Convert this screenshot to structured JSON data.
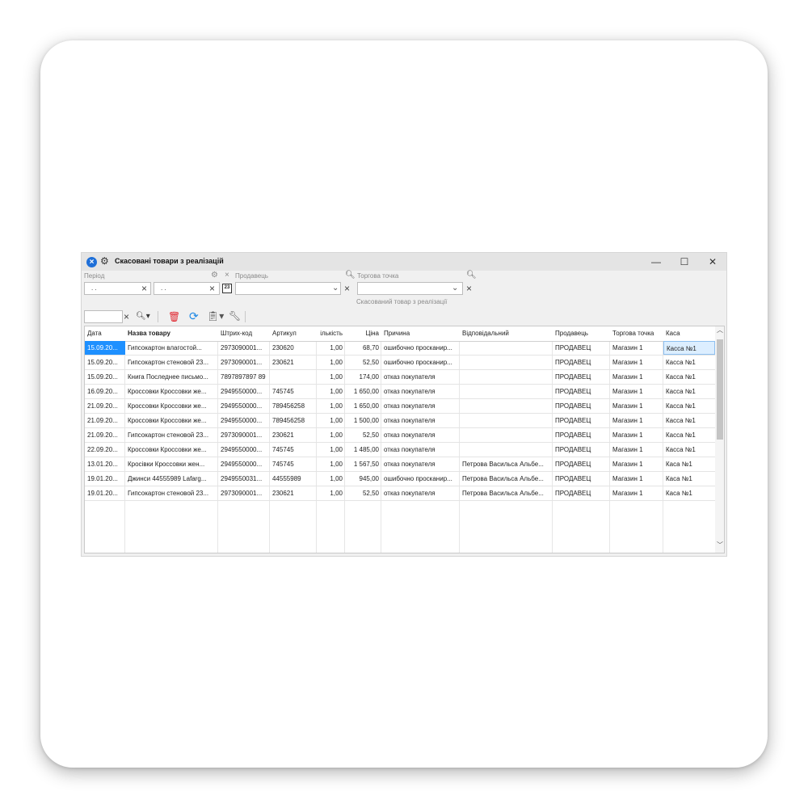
{
  "window": {
    "title": "Скасовані товари з реалізацій",
    "controls": {
      "minimize": "—",
      "maximize": "☐",
      "close": "✕"
    }
  },
  "filters": {
    "period_label": "Період",
    "date_from": ". .",
    "date_to": ". .",
    "seller_label": "Продавець",
    "store_label": "Торгова точка",
    "calendar_text": "23",
    "hint": "Скасований товар з реалізації"
  },
  "grid": {
    "columns": [
      "Дата",
      "Назва товару",
      "Штрих-код",
      "Артикул",
      "ількість",
      "Ціна",
      "Причина",
      "Відповідальний",
      "Продавець",
      "Торгова точка",
      "Каса"
    ],
    "rows": [
      [
        "15.09.20...",
        "Гипсокартон влагостой...",
        "2973090001...",
        "230620",
        "1,00",
        "68,70",
        "ошибочно просканир...",
        "",
        "ПРОДАВЕЦ",
        "Магазин 1",
        "Касса №1"
      ],
      [
        "15.09.20...",
        "Гипсокартон стеновой 23...",
        "2973090001...",
        "230621",
        "1,00",
        "52,50",
        "ошибочно просканир...",
        "",
        "ПРОДАВЕЦ",
        "Магазин 1",
        "Касса №1"
      ],
      [
        "15.09.20...",
        "Книга Последнее письмо...",
        "7897897897 89",
        "",
        "1,00",
        "174,00",
        "отказ покупателя",
        "",
        "ПРОДАВЕЦ",
        "Магазин 1",
        "Касса №1"
      ],
      [
        "16.09.20...",
        "Кроссовки Кроссовки же...",
        "2949550000...",
        "745745",
        "1,00",
        "1 650,00",
        "отказ покупателя",
        "",
        "ПРОДАВЕЦ",
        "Магазин 1",
        "Касса №1"
      ],
      [
        "21.09.20...",
        "Кроссовки Кроссовки же...",
        "2949550000...",
        "789456258",
        "1,00",
        "1 650,00",
        "отказ покупателя",
        "",
        "ПРОДАВЕЦ",
        "Магазин 1",
        "Касса №1"
      ],
      [
        "21.09.20...",
        "Кроссовки Кроссовки же...",
        "2949550000...",
        "789456258",
        "1,00",
        "1 500,00",
        "отказ покупателя",
        "",
        "ПРОДАВЕЦ",
        "Магазин 1",
        "Касса №1"
      ],
      [
        "21.09.20...",
        "Гипсокартон стеновой 23...",
        "2973090001...",
        "230621",
        "1,00",
        "52,50",
        "отказ покупателя",
        "",
        "ПРОДАВЕЦ",
        "Магазин 1",
        "Касса №1"
      ],
      [
        "22.09.20...",
        "Кроссовки Кроссовки же...",
        "2949550000...",
        "745745",
        "1,00",
        "1 485,00",
        "отказ покупателя",
        "",
        "ПРОДАВЕЦ",
        "Магазин 1",
        "Касса №1"
      ],
      [
        "13.01.20...",
        "Кросівки Кроссовки жен...",
        "2949550000...",
        "745745",
        "1,00",
        "1 567,50",
        "отказ покупателя",
        "Петрова Васильса Альбе...",
        "ПРОДАВЕЦ",
        "Магазин 1",
        "Каса №1"
      ],
      [
        "19.01.20...",
        "Джинси 44555989 Lafarg...",
        "2949550031...",
        "44555989",
        "1,00",
        "945,00",
        "ошибочно просканир...",
        "Петрова Васильса Альбе...",
        "ПРОДАВЕЦ",
        "Магазин 1",
        "Каса №1"
      ],
      [
        "19.01.20...",
        "Гипсокартон стеновой 23...",
        "2973090001...",
        "230621",
        "1,00",
        "52,50",
        "отказ покупателя",
        "Петрова Васильса Альбе...",
        "ПРОДАВЕЦ",
        "Магазин 1",
        "Каса №1"
      ]
    ]
  },
  "icons": {
    "title": "close-circle-icon",
    "settings": "gear-icon",
    "search": "search-icon",
    "delete": "trash-icon",
    "refresh": "refresh-icon",
    "export": "clipboard-icon",
    "tools": "wrench-icon"
  }
}
